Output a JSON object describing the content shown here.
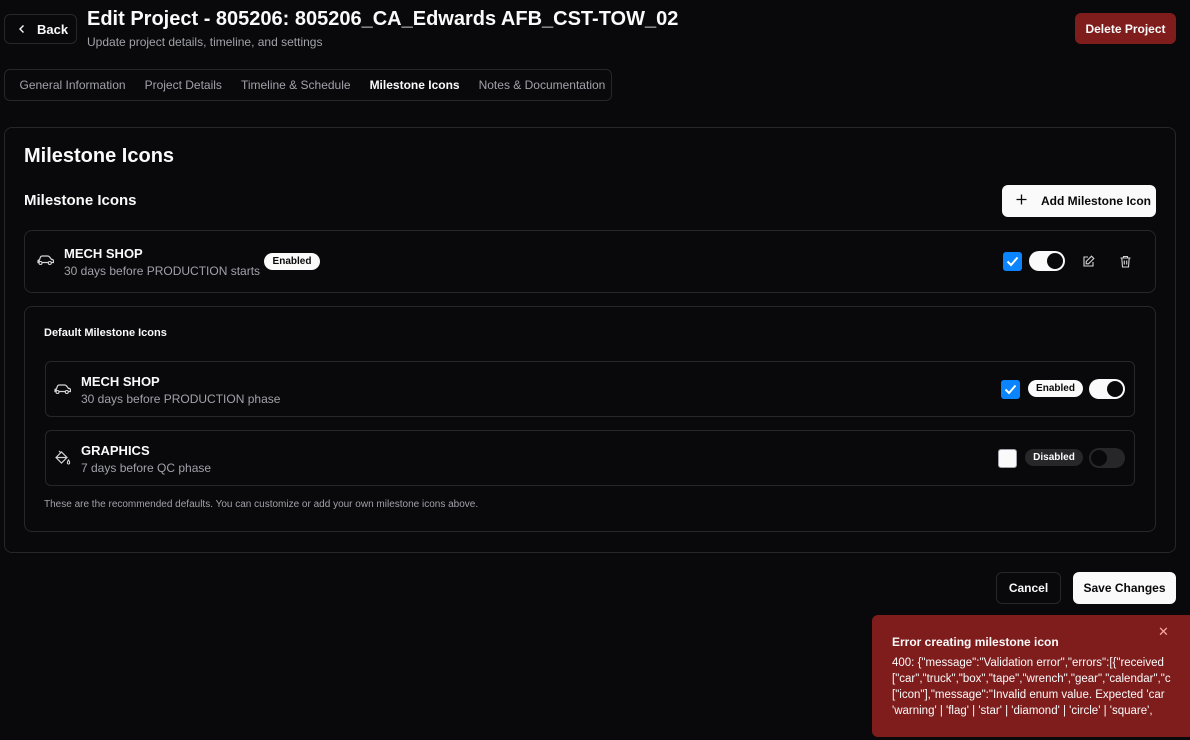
{
  "header": {
    "back_label": "Back",
    "title": "Edit Project - 805206: 805206_CA_Edwards AFB_CST-TOW_02",
    "subtitle": "Update project details, timeline, and settings",
    "delete_label": "Delete Project"
  },
  "tabs": [
    {
      "label": "General Information"
    },
    {
      "label": "Project Details"
    },
    {
      "label": "Timeline & Schedule"
    },
    {
      "label": "Milestone Icons",
      "active": true
    },
    {
      "label": "Notes & Documentation"
    }
  ],
  "card": {
    "title": "Milestone Icons",
    "section_title": "Milestone Icons",
    "add_label": "Add Milestone Icon"
  },
  "milestones": [
    {
      "icon": "car-icon",
      "name": "MECH SHOP",
      "desc": "30 days before PRODUCTION starts",
      "badge": "Enabled",
      "checked": true,
      "enabled": true
    }
  ],
  "defaults": {
    "title": "Default Milestone Icons",
    "items": [
      {
        "icon": "car-icon",
        "name": "MECH SHOP",
        "desc": "30 days before PRODUCTION phase",
        "badge": "Enabled",
        "checked": true,
        "enabled": true
      },
      {
        "icon": "paint-bucket-icon",
        "name": "GRAPHICS",
        "desc": "7 days before QC phase",
        "badge": "Disabled",
        "checked": false,
        "enabled": false
      }
    ],
    "footnote": "These are the recommended defaults. You can customize or add your own milestone icons above."
  },
  "footer": {
    "cancel_label": "Cancel",
    "save_label": "Save Changes"
  },
  "toast": {
    "title": "Error creating milestone icon",
    "lines": [
      "400: {\"message\":\"Validation error\",\"errors\":[{\"received",
      "[\"car\",\"truck\",\"box\",\"tape\",\"wrench\",\"gear\",\"calendar\",\"c",
      "[\"icon\"],\"message\":\"Invalid enum value. Expected 'car",
      "'warning' | 'flag' | 'star' | 'diamond' | 'circle' | 'square',"
    ]
  },
  "colors": {
    "background": "#09090b",
    "border": "#27272a",
    "danger": "#7f1d1d",
    "checkbox": "#0a84ff"
  }
}
